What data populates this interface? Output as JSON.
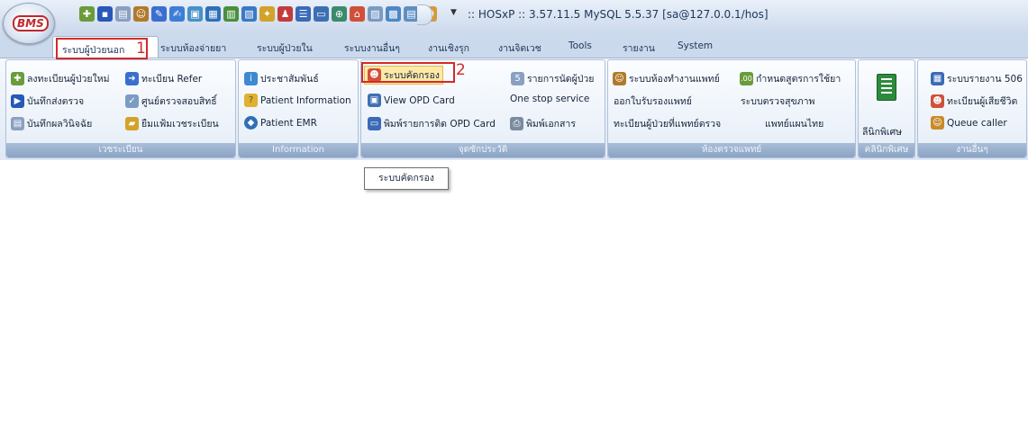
{
  "window": {
    "title": ":: HOSxP :: 3.57.11.5 MySQL 5.5.37 [sa@127.0.0.1/hos]",
    "app_logo": "BMS"
  },
  "quick_access": [
    {
      "icon": "people-add-icon",
      "color": "#6a9c3b"
    },
    {
      "icon": "blue-square-icon",
      "color": "#2858b8"
    },
    {
      "icon": "document-icon",
      "color": "#8aa0c0"
    },
    {
      "icon": "person-icon",
      "color": "#b07a2c"
    },
    {
      "icon": "pen-icon",
      "color": "#3a6fcf"
    },
    {
      "icon": "edit-icon",
      "color": "#3d7dd8"
    },
    {
      "icon": "doc-check-icon",
      "color": "#4a90c8"
    },
    {
      "icon": "table-icon",
      "color": "#2f6fba"
    },
    {
      "icon": "grid-icon",
      "color": "#4a8f3f"
    },
    {
      "icon": "calendar-icon",
      "color": "#3c78c5"
    },
    {
      "icon": "syringe-icon",
      "color": "#d3a22b"
    },
    {
      "icon": "patient-icon",
      "color": "#c33c3c"
    },
    {
      "icon": "list-icon",
      "color": "#3a6ab8"
    },
    {
      "icon": "monitor-icon",
      "color": "#3d70b3"
    },
    {
      "icon": "globe-icon",
      "color": "#3b8a6b"
    },
    {
      "icon": "home-icon",
      "color": "#d1503a"
    },
    {
      "icon": "chart-icon",
      "color": "#7a9cc4"
    },
    {
      "icon": "screen-icon",
      "color": "#4d87c5"
    },
    {
      "icon": "photo-icon",
      "color": "#5f8fc0"
    },
    {
      "icon": "figure-icon",
      "color": "#d59a3b"
    }
  ],
  "tabs": [
    {
      "label": "ระบบผู้ป่วยนอก",
      "active": true
    },
    {
      "label": "ระบบห้องจ่ายยา"
    },
    {
      "label": "ระบบผู้ป่วยใน"
    },
    {
      "label": "ระบบงานอื่นๆ"
    },
    {
      "label": "งานเชิงรุก"
    },
    {
      "label": "งานจิตเวช"
    },
    {
      "label": "Tools"
    },
    {
      "label": "รายงาน"
    },
    {
      "label": "System"
    }
  ],
  "annotations": {
    "step1": "1",
    "step2": "2"
  },
  "groups": [
    {
      "label": "เวชระเบียน",
      "items": [
        {
          "label": "ลงทะเบียนผู้ป่วยใหม่",
          "icon": "register-patient-icon",
          "color": "#6a9c3b"
        },
        {
          "label": "ทะเบียน Refer",
          "icon": "refer-arrow-icon",
          "color": "#3a6fcf"
        },
        {
          "label": "บันทึกส่งตรวจ",
          "icon": "send-exam-icon",
          "color": "#2858b8"
        },
        {
          "label": "ศูนย์ตรวจสอบสิทธิ์",
          "icon": "rights-check-icon",
          "color": "#7a9cc4"
        },
        {
          "label": "บันทึกผลวินิจฉัย",
          "icon": "diagnosis-doc-icon",
          "color": "#8aa0c0"
        },
        {
          "label": "ยืมแฟ้มเวชระเบียน",
          "icon": "borrow-folder-icon",
          "color": "#d3a22b"
        }
      ]
    },
    {
      "label": "Information",
      "items": [
        {
          "label": "ประชาสัมพันธ์",
          "icon": "public-relations-icon",
          "color": "#3d8ad0"
        },
        {
          "label": "Patient Information",
          "icon": "question-icon",
          "color": "#e0b030"
        },
        {
          "label": "Patient EMR",
          "icon": "emr-icon",
          "color": "#2f6fba"
        }
      ]
    },
    {
      "label": "จุดซักประวัติ",
      "items": [
        {
          "label": "ระบบคัดกรอง",
          "icon": "screening-people-icon",
          "color": "#d1503a"
        },
        {
          "label": "รายการนัดผู้ป่วย",
          "icon": "appointment-icon",
          "color": "#8aa0c0"
        },
        {
          "label": "View OPD Card",
          "icon": "opd-card-icon",
          "color": "#3d70b3"
        },
        {
          "label": "One stop service",
          "icon": "",
          "color": ""
        },
        {
          "label": "พิมพ์รายการติด OPD Card",
          "icon": "print-card-icon",
          "color": "#3a6ab8"
        },
        {
          "label": "พิมพ์เอกสาร",
          "icon": "printer-icon",
          "color": "#7a8aa0"
        }
      ]
    },
    {
      "label": "ห้องตรวจแพทย์",
      "items": [
        {
          "label": "ระบบห้องทำงานแพทย์",
          "icon": "doctor-room-icon",
          "color": "#b07a2c"
        },
        {
          "label": "กำหนดสูตรการใช้ยา",
          "icon": "drug-formula-icon",
          "color": "#6a9c3b"
        },
        {
          "label": "ออกใบรับรองแพทย์",
          "icon": "",
          "color": ""
        },
        {
          "label": "ระบบตรวจสุขภาพ",
          "icon": "",
          "color": ""
        },
        {
          "label": "ทะเบียนผู้ป่วยที่แพทย์ตรวจ",
          "icon": "",
          "color": ""
        },
        {
          "label": "แพทย์แผนไทย",
          "icon": "",
          "color": ""
        }
      ]
    },
    {
      "label": "คลินิกพิเศษ",
      "items": [
        {
          "label": "ลีนิกพิเศษ",
          "icon": "special-clinic-icon",
          "color": "#2e8b3e"
        }
      ]
    },
    {
      "label": "งานอื่นๆ",
      "items": [
        {
          "label": "ระบบรายงาน 506",
          "icon": "report-506-icon",
          "color": "#3a6ab8"
        },
        {
          "label": "ทะเบียนผู้เสียชีวิต",
          "icon": "death-registry-icon",
          "color": "#d1503a"
        },
        {
          "label": "Queue caller",
          "icon": "queue-caller-icon",
          "color": "#c98a2b"
        }
      ]
    }
  ],
  "tooltip": {
    "text": "ระบบคัดกรอง"
  }
}
